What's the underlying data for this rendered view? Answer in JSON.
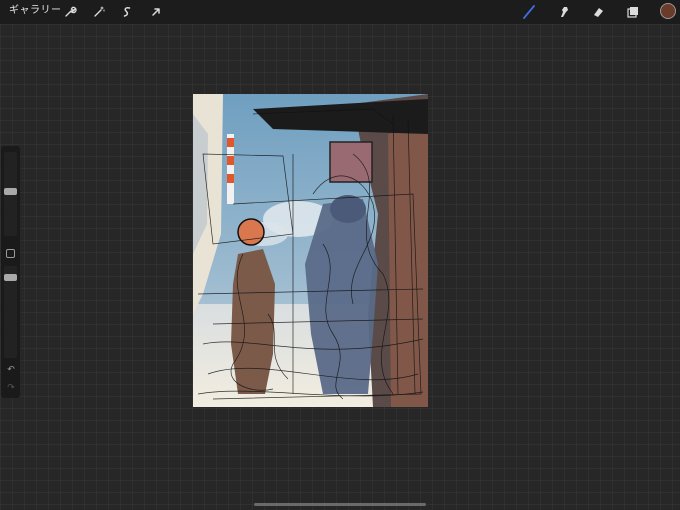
{
  "toolbar": {
    "gallery_label": "ギャラリー",
    "left_tools": [
      "wrench-icon",
      "magic-wand-icon",
      "selection-icon",
      "transform-arrow-icon"
    ],
    "right_tools": [
      "brush-icon",
      "smudge-icon",
      "eraser-icon",
      "layers-icon"
    ],
    "active_tool": "brush-icon",
    "accent_color": "#3b6fe0",
    "current_color": "#6a3a2a"
  },
  "sidebar": {
    "brush_size_label": "brush size",
    "opacity_label": "opacity",
    "undo_icon": "↶",
    "redo_icon": "↷"
  }
}
